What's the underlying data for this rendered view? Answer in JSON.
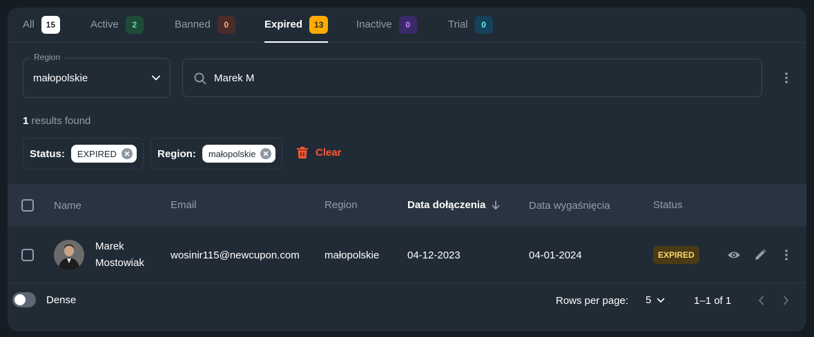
{
  "tabs": [
    {
      "label": "All",
      "count": "15"
    },
    {
      "label": "Active",
      "count": "2"
    },
    {
      "label": "Banned",
      "count": "0"
    },
    {
      "label": "Expired",
      "count": "13"
    },
    {
      "label": "Inactive",
      "count": "0"
    },
    {
      "label": "Trial",
      "count": "0"
    }
  ],
  "active_tab": "Expired",
  "filters": {
    "region_label": "Region",
    "region_value": "małopolskie",
    "search_value": "Marek M"
  },
  "results": {
    "count": "1",
    "text": " results found"
  },
  "chips": {
    "status_label": "Status:",
    "status_value": "EXPIRED",
    "region_label": "Region:",
    "region_value": "małopolskie",
    "clear_label": "Clear"
  },
  "table": {
    "headers": {
      "name": "Name",
      "email": "Email",
      "region": "Region",
      "joined": "Data dołączenia",
      "expires": "Data wygaśnięcia",
      "status": "Status"
    },
    "rows": [
      {
        "name_first": "Marek",
        "name_last": "Mostowiak",
        "email": "wosinir115@newcupon.com",
        "region": "małopolskie",
        "joined": "04-12-2023",
        "expires": "04-01-2024",
        "status": "EXPIRED"
      }
    ]
  },
  "footer": {
    "dense_label": "Dense",
    "rows_per_page_label": "Rows per page:",
    "rows_per_page_value": "5",
    "pagination_info": "1–1 of 1"
  },
  "icons": {
    "search": "search-icon",
    "chevron": "chevron-down-icon",
    "more": "more-vertical-icon",
    "close": "close-icon",
    "trash": "trash-icon",
    "eye": "eye-icon",
    "pencil": "pencil-icon",
    "arrow_down": "arrow-down-icon",
    "prev": "chevron-left-icon",
    "next": "chevron-right-icon"
  },
  "colors": {
    "background": "#161c24",
    "card": "#212b36",
    "expired_accent": "#ffab00",
    "danger": "#ff5630"
  }
}
